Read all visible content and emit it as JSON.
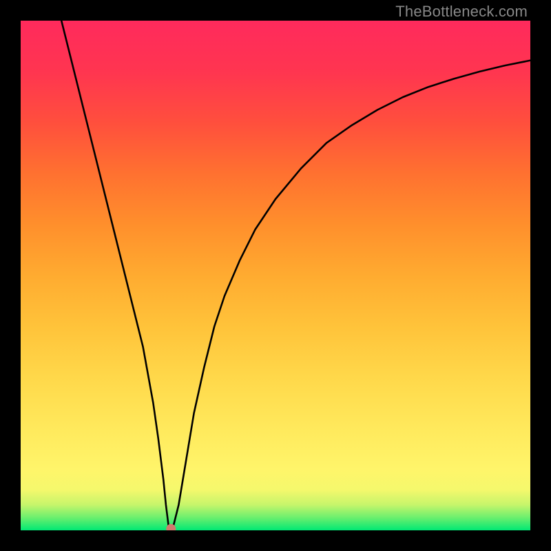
{
  "watermark": "TheBottleneck.com",
  "chart_data": {
    "type": "line",
    "title": "",
    "xlabel": "",
    "ylabel": "",
    "xlim": [
      0,
      100
    ],
    "ylim": [
      0,
      100
    ],
    "series": [
      {
        "name": "bottleneck-curve",
        "x": [
          8,
          10,
          12,
          14,
          16,
          18,
          20,
          22,
          24,
          26,
          27,
          28,
          28.5,
          29,
          29.5,
          30,
          31,
          32,
          33,
          34,
          36,
          38,
          40,
          43,
          46,
          50,
          55,
          60,
          65,
          70,
          75,
          80,
          85,
          90,
          95,
          100
        ],
        "y": [
          100,
          92,
          84,
          76,
          68,
          60,
          52,
          44,
          36,
          25,
          18,
          10,
          5,
          1,
          0.3,
          1,
          5,
          11,
          17,
          23,
          32,
          40,
          46,
          53,
          59,
          65,
          71,
          76,
          79.5,
          82.5,
          85,
          87,
          88.6,
          90,
          91.2,
          92.2
        ]
      }
    ],
    "marker": {
      "x": 29.5,
      "y": 0.3,
      "color": "#cf7a6e",
      "radius_px": 7
    },
    "gradient_stops": [
      {
        "pct": 0,
        "color": "#00e874"
      },
      {
        "pct": 2.5,
        "color": "#6bef6e"
      },
      {
        "pct": 5,
        "color": "#c6f56b"
      },
      {
        "pct": 8,
        "color": "#f5f86c"
      },
      {
        "pct": 12,
        "color": "#fff56a"
      },
      {
        "pct": 20,
        "color": "#ffe95c"
      },
      {
        "pct": 30,
        "color": "#ffd84a"
      },
      {
        "pct": 40,
        "color": "#ffc33a"
      },
      {
        "pct": 50,
        "color": "#ffab30"
      },
      {
        "pct": 60,
        "color": "#ff8f2c"
      },
      {
        "pct": 70,
        "color": "#ff7130"
      },
      {
        "pct": 80,
        "color": "#ff4f3d"
      },
      {
        "pct": 90,
        "color": "#ff3550"
      },
      {
        "pct": 100,
        "color": "#ff2a5c"
      }
    ]
  }
}
